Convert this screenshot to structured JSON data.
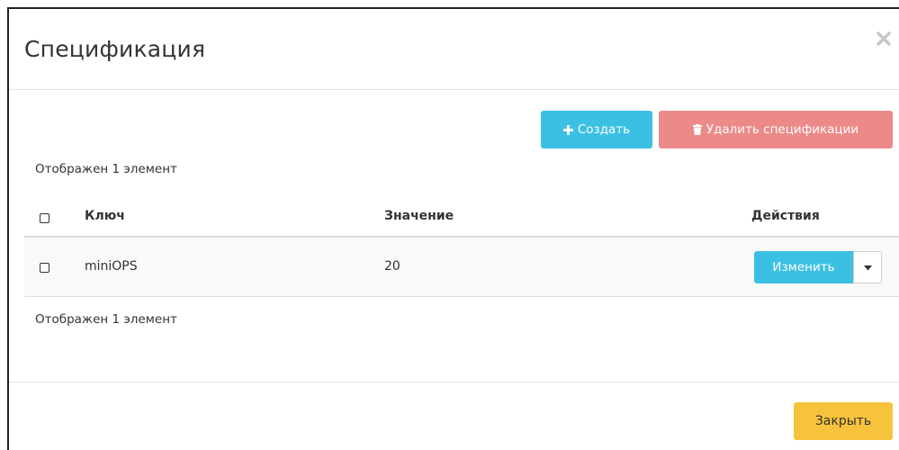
{
  "modal": {
    "title": "Спецификация"
  },
  "toolbar": {
    "create_label": "Создать",
    "delete_label": "Удалить спецификации"
  },
  "table": {
    "count_top": "Отображен 1 элемент",
    "count_bottom": "Отображен 1 элемент",
    "columns": [
      "Ключ",
      "Значение",
      "Действия"
    ],
    "rows": [
      {
        "key": "miniOPS",
        "value": "20",
        "action_label": "Изменить"
      }
    ]
  },
  "footer": {
    "close_label": "Закрыть"
  },
  "colors": {
    "primary": "#3bc0e3",
    "danger": "#eb8a88",
    "warning": "#f7c33c"
  },
  "icons": {
    "close": "close-icon",
    "create": "plus-icon",
    "delete": "trash-icon",
    "dropdown": "caret-down-icon"
  }
}
